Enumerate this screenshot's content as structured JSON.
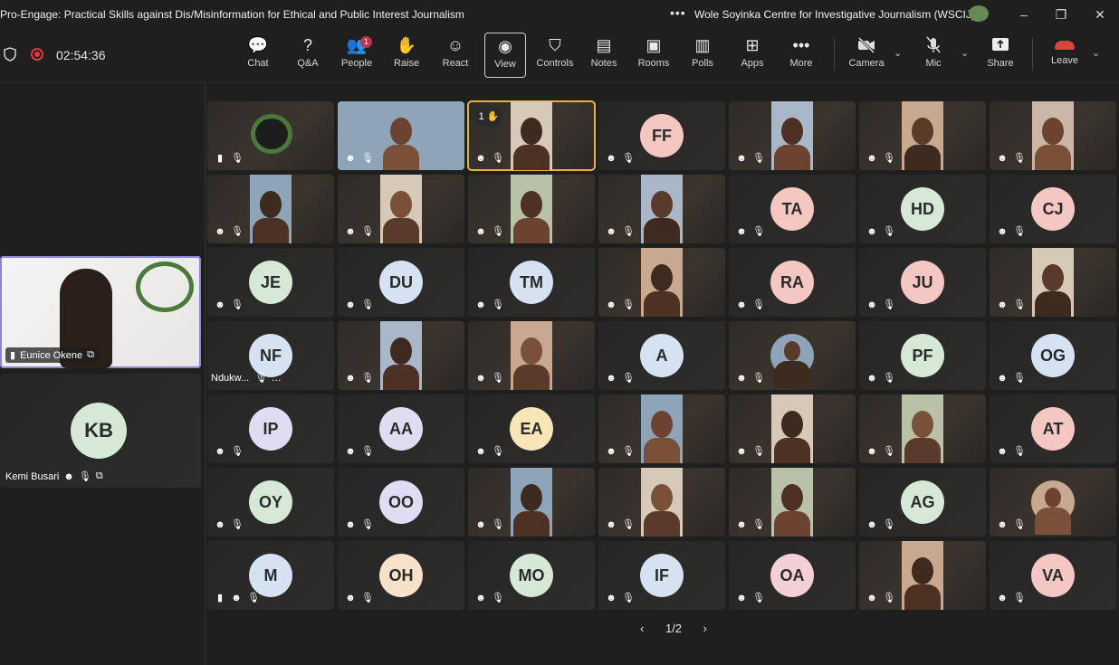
{
  "window": {
    "title": "Pro-Engage: Practical Skills against Dis/Misinformation for Ethical and Public Interest Journalism",
    "more_dots": "•••",
    "organization": "Wole Soyinka Centre for Investigative Journalism (WSCIJ)",
    "minimize": "–",
    "restore": "❐",
    "close": "✕"
  },
  "toolbar": {
    "timer": "02:54:36",
    "buttons": [
      {
        "label": "Chat",
        "icon": "chat-icon",
        "glyph": "💬"
      },
      {
        "label": "Q&A",
        "icon": "qa-icon",
        "glyph": "?"
      },
      {
        "label": "People",
        "icon": "people-icon",
        "glyph": "👥",
        "badge": "1"
      },
      {
        "label": "Raise",
        "icon": "hand-icon",
        "glyph": "✋"
      },
      {
        "label": "React",
        "icon": "smile-icon",
        "glyph": "☺"
      },
      {
        "label": "View",
        "icon": "view-icon",
        "glyph": "◉"
      },
      {
        "label": "Controls",
        "icon": "controls-icon",
        "glyph": "⛉"
      },
      {
        "label": "Notes",
        "icon": "notes-icon",
        "glyph": "▤"
      },
      {
        "label": "Rooms",
        "icon": "rooms-icon",
        "glyph": "▣"
      },
      {
        "label": "Polls",
        "icon": "polls-icon",
        "glyph": "▥"
      },
      {
        "label": "Apps",
        "icon": "apps-icon",
        "glyph": "⊞"
      },
      {
        "label": "More",
        "icon": "more-icon",
        "glyph": "•••"
      }
    ],
    "camera_label": "Camera",
    "mic_label": "Mic",
    "share_label": "Share",
    "leave_label": "Leave"
  },
  "left_panel": {
    "spotlight_name": "Eunice Okene",
    "second_initials": "KB",
    "second_name": "Kemi Busari"
  },
  "colors": {
    "accent_selected": "#e8b13b",
    "leave_red": "#d9443b",
    "record_red": "#e03a3a",
    "badge": "#c4314b"
  },
  "grid": [
    {
      "kind": "logo"
    },
    {
      "kind": "video"
    },
    {
      "kind": "video",
      "hand": "1 ✋",
      "selected": true
    },
    {
      "kind": "avatar",
      "initials": "FF",
      "color": "#f4c7c3"
    },
    {
      "kind": "video"
    },
    {
      "kind": "video"
    },
    {
      "kind": "video"
    },
    {
      "kind": "video"
    },
    {
      "kind": "video"
    },
    {
      "kind": "video"
    },
    {
      "kind": "video"
    },
    {
      "kind": "avatar",
      "initials": "TA",
      "color": "#f4c7c3"
    },
    {
      "kind": "avatar",
      "initials": "HD",
      "color": "#d6e9d6"
    },
    {
      "kind": "avatar",
      "initials": "CJ",
      "color": "#f4c7c3"
    },
    {
      "kind": "avatar",
      "initials": "JE",
      "color": "#d6e9d6"
    },
    {
      "kind": "avatar",
      "initials": "DU",
      "color": "#d4e2f2"
    },
    {
      "kind": "avatar",
      "initials": "TM",
      "color": "#d4e2f2"
    },
    {
      "kind": "video"
    },
    {
      "kind": "avatar",
      "initials": "RA",
      "color": "#f4c7c3"
    },
    {
      "kind": "avatar",
      "initials": "JU",
      "color": "#f4c7c3"
    },
    {
      "kind": "video"
    },
    {
      "kind": "avatar",
      "initials": "NF",
      "color": "#d4e2f2",
      "name": "Ndukw..."
    },
    {
      "kind": "video"
    },
    {
      "kind": "video"
    },
    {
      "kind": "avatar",
      "initials": "A",
      "color": "#d4e2f2"
    },
    {
      "kind": "photo"
    },
    {
      "kind": "avatar",
      "initials": "PF",
      "color": "#d6e9d6"
    },
    {
      "kind": "avatar",
      "initials": "OG",
      "color": "#d4e2f2"
    },
    {
      "kind": "avatar",
      "initials": "IP",
      "color": "#e2dcf2"
    },
    {
      "kind": "avatar",
      "initials": "AA",
      "color": "#e2dcf2"
    },
    {
      "kind": "avatar",
      "initials": "EA",
      "color": "#f7e6b8"
    },
    {
      "kind": "video"
    },
    {
      "kind": "video"
    },
    {
      "kind": "video"
    },
    {
      "kind": "avatar",
      "initials": "AT",
      "color": "#f4c7c3"
    },
    {
      "kind": "avatar",
      "initials": "OY",
      "color": "#d6e9d6"
    },
    {
      "kind": "avatar",
      "initials": "OO",
      "color": "#e2dcf2"
    },
    {
      "kind": "video"
    },
    {
      "kind": "video"
    },
    {
      "kind": "video"
    },
    {
      "kind": "avatar",
      "initials": "AG",
      "color": "#d6e9d6"
    },
    {
      "kind": "photo"
    },
    {
      "kind": "avatar",
      "initials": "M",
      "color": "#d4e2f2"
    },
    {
      "kind": "avatar",
      "initials": "OH",
      "color": "#f7e1c8"
    },
    {
      "kind": "avatar",
      "initials": "MO",
      "color": "#d6e9d6"
    },
    {
      "kind": "avatar",
      "initials": "IF",
      "color": "#d4e2f2"
    },
    {
      "kind": "avatar",
      "initials": "OA",
      "color": "#f4d0d6"
    },
    {
      "kind": "video"
    },
    {
      "kind": "avatar",
      "initials": "VA",
      "color": "#f4c7c3"
    }
  ],
  "pager": {
    "prev": "‹",
    "text": "1/2",
    "next": "›"
  },
  "status_icons": {
    "reactions": "reaction-icon",
    "mic_off": "mic-off-icon",
    "signal": "signal-icon",
    "more": "more-icon"
  }
}
